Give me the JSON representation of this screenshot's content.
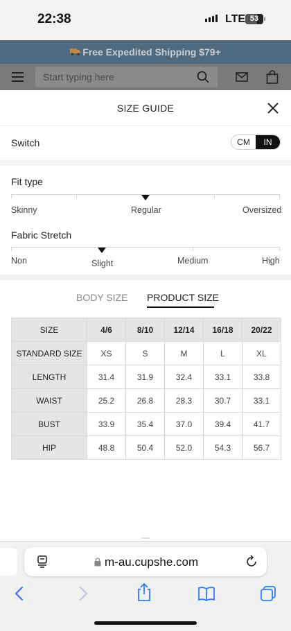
{
  "status_bar": {
    "time": "22:38",
    "network": "LTE",
    "battery": "53"
  },
  "promo_banner": {
    "text": "Free Expedited Shipping $79+",
    "icon": "truck-icon"
  },
  "site_header": {
    "search_placeholder": "Start typing here",
    "icons": [
      "menu-icon",
      "search-icon",
      "mail-icon",
      "bag-icon"
    ]
  },
  "modal": {
    "title": "SIZE GUIDE",
    "switch_label": "Switch",
    "units": [
      "CM",
      "IN"
    ],
    "selected_unit": "IN",
    "fit_type": {
      "title": "Fit type",
      "labels": [
        "Skinny",
        "Regular",
        "Oversized"
      ],
      "selected": "Regular"
    },
    "fabric_stretch": {
      "title": "Fabric Stretch",
      "labels": [
        "Non",
        "Slight",
        "Medium",
        "High"
      ],
      "selected": "Slight"
    },
    "tabs": [
      "BODY SIZE",
      "PRODUCT SIZE"
    ],
    "active_tab": "PRODUCT SIZE",
    "table": {
      "header": [
        "SIZE",
        "4/6",
        "8/10",
        "12/14",
        "16/18",
        "20/22"
      ],
      "rows": [
        [
          "STANDARD SIZE",
          "XS",
          "S",
          "M",
          "L",
          "XL"
        ],
        [
          "LENGTH",
          "31.4",
          "31.9",
          "32.4",
          "33.1",
          "33.8"
        ],
        [
          "WAIST",
          "25.2",
          "26.8",
          "28.3",
          "30.7",
          "33.1"
        ],
        [
          "BUST",
          "33.9",
          "35.4",
          "37.0",
          "39.4",
          "41.7"
        ],
        [
          "HIP",
          "48.8",
          "50.4",
          "52.0",
          "54.3",
          "56.7"
        ]
      ]
    }
  },
  "browser": {
    "url": "m-au.cupshe.com"
  },
  "colors": {
    "promo_bg": "#4f6a7e",
    "accent": "#111111",
    "table_header_bg": "#e5e5e5"
  }
}
